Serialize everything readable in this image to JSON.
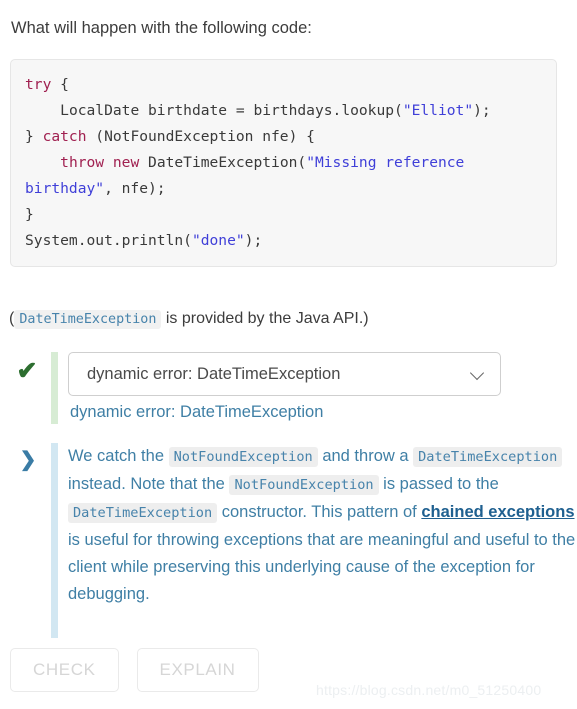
{
  "question": {
    "prompt": "What will happen with the following code:"
  },
  "code": {
    "language": "java",
    "tokens": [
      {
        "t": "try",
        "c": "kw"
      },
      {
        "t": " {\n    LocalDate birthdate = birthdays.lookup(",
        "c": "pln"
      },
      {
        "t": "\"Elliot\"",
        "c": "str"
      },
      {
        "t": ");\n} ",
        "c": "pln"
      },
      {
        "t": "catch",
        "c": "kw"
      },
      {
        "t": " (NotFoundException nfe) {\n    ",
        "c": "pln"
      },
      {
        "t": "throw",
        "c": "kw"
      },
      {
        "t": " ",
        "c": "pln"
      },
      {
        "t": "new",
        "c": "kw"
      },
      {
        "t": " DateTimeException(",
        "c": "pln"
      },
      {
        "t": "\"Missing reference birthday\"",
        "c": "str"
      },
      {
        "t": ", nfe);\n}\nSystem.out.println(",
        "c": "pln"
      },
      {
        "t": "\"done\"",
        "c": "str"
      },
      {
        "t": ");",
        "c": "pln"
      }
    ],
    "plain_text": "try {\n    LocalDate birthdate = birthdays.lookup(\"Elliot\");\n} catch (NotFoundException nfe) {\n    throw new DateTimeException(\"Missing reference birthday\", nfe);\n}\nSystem.out.println(\"done\");"
  },
  "note": {
    "open_paren": "(",
    "code_term": "DateTimeException",
    "tail": " is provided by the Java API.)"
  },
  "answer": {
    "status_icon": "check-icon",
    "status": "correct",
    "selected_option": "dynamic error: DateTimeException",
    "echo_text": "dynamic error: DateTimeException",
    "caret_icon": "chevron-down-icon",
    "bar_color": "#d7ecd4",
    "check_color": "#2d6e30"
  },
  "explanation": {
    "icon": "chevron-right-icon",
    "bar_color": "#d2e7f2",
    "text_color": "#3f7fa5",
    "parts": [
      {
        "type": "text",
        "value": "We catch the "
      },
      {
        "type": "code",
        "value": "NotFoundException"
      },
      {
        "type": "text",
        "value": " and throw a "
      },
      {
        "type": "code",
        "value": "DateTimeException"
      },
      {
        "type": "text",
        "value": " instead. Note that the "
      },
      {
        "type": "code",
        "value": "NotFoundException"
      },
      {
        "type": "text",
        "value": " is passed to the "
      },
      {
        "type": "code",
        "value": "DateTimeException"
      },
      {
        "type": "text",
        "value": " constructor. This pattern of "
      },
      {
        "type": "link",
        "value": "chained exceptions"
      },
      {
        "type": "text",
        "value": " is useful for throwing exceptions that are meaningful and useful to the client while preserving this underlying cause of the exception for debugging."
      }
    ],
    "plain_text": "We catch the NotFoundException and throw a DateTimeException instead. Note that the NotFoundException is passed to the DateTimeException constructor. This pattern of chained exceptions is useful for throwing exceptions that are meaningful and useful to the client while preserving this underlying cause of the exception for debugging."
  },
  "buttons": {
    "check_label": "CHECK",
    "explain_label": "EXPLAIN",
    "disabled": true
  },
  "watermark": {
    "text": "https://blog.csdn.net/m0_51250400"
  }
}
